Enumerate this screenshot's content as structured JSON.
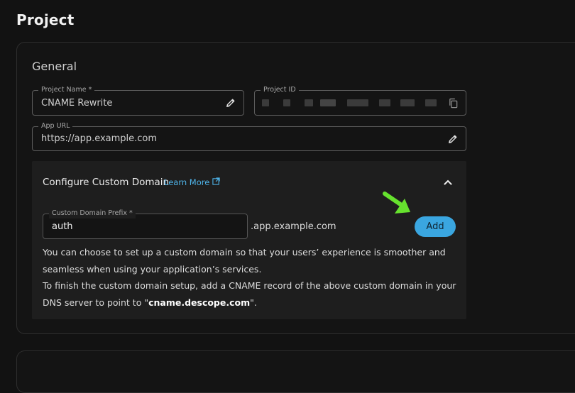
{
  "page": {
    "title": "Project"
  },
  "general": {
    "title": "General",
    "project_name": {
      "label": "Project Name *",
      "value": "CNAME Rewrite",
      "icon": "pencil-icon"
    },
    "project_id": {
      "label": "Project ID",
      "icon": "copy-icon"
    },
    "app_url": {
      "label": "App URL",
      "value": "https://app.example.com",
      "icon": "pencil-icon"
    }
  },
  "custom_domain": {
    "title": "Configure Custom Domain",
    "learn_more": "Learn More",
    "prefix_label": "Custom Domain Prefix *",
    "prefix_value": "auth",
    "suffix": ".app.example.com",
    "add_label": "Add",
    "desc_line1": "You can choose to set up a custom domain so that your users’ experience is smoother and seamless when using your application’s services.",
    "desc_line2_pre": "To finish the custom domain setup, add a CNAME record of the above custom domain in your DNS server to point to \"",
    "desc_line2_bold": "cname.descope.com",
    "desc_line2_post": "\"."
  },
  "colors": {
    "accent": "#3aa6e0",
    "link": "#4eb3e8",
    "arrow": "#66e22e"
  }
}
